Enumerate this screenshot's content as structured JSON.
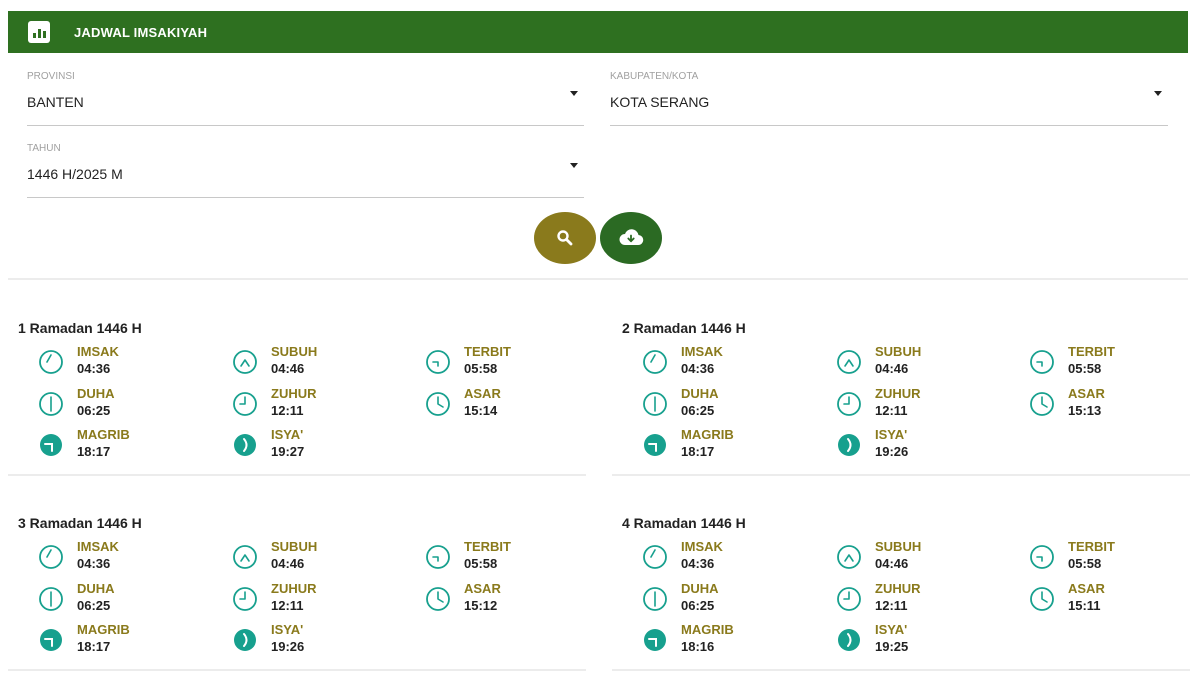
{
  "header": {
    "title": "JADWAL IMSAKIYAH",
    "icon": "bar-chart-icon"
  },
  "filters": {
    "provinsi": {
      "label": "PROVINSI",
      "value": "BANTEN"
    },
    "kota": {
      "label": "KABUPATEN/KOTA",
      "value": "KOTA SERANG"
    },
    "tahun": {
      "label": "TAHUN",
      "value": "1446 H/2025 M"
    }
  },
  "actions": {
    "search_icon": "search-icon",
    "download_icon": "cloud-download-icon"
  },
  "colors": {
    "header": "#2e7020",
    "search_button": "#8a7a1c",
    "download_button": "#2b6a23",
    "icon_teal": "#17a08e",
    "label_olive": "#8a7a1c"
  },
  "days": [
    {
      "title": "1 Ramadan 1446 H",
      "times": [
        {
          "name": "IMSAK",
          "time": "04:36"
        },
        {
          "name": "SUBUH",
          "time": "04:46"
        },
        {
          "name": "TERBIT",
          "time": "05:58"
        },
        {
          "name": "DUHA",
          "time": "06:25"
        },
        {
          "name": "ZUHUR",
          "time": "12:11"
        },
        {
          "name": "ASAR",
          "time": "15:14"
        },
        {
          "name": "MAGRIB",
          "time": "18:17"
        },
        {
          "name": "ISYA'",
          "time": "19:27"
        }
      ]
    },
    {
      "title": "2 Ramadan 1446 H",
      "times": [
        {
          "name": "IMSAK",
          "time": "04:36"
        },
        {
          "name": "SUBUH",
          "time": "04:46"
        },
        {
          "name": "TERBIT",
          "time": "05:58"
        },
        {
          "name": "DUHA",
          "time": "06:25"
        },
        {
          "name": "ZUHUR",
          "time": "12:11"
        },
        {
          "name": "ASAR",
          "time": "15:13"
        },
        {
          "name": "MAGRIB",
          "time": "18:17"
        },
        {
          "name": "ISYA'",
          "time": "19:26"
        }
      ]
    },
    {
      "title": "3 Ramadan 1446 H",
      "times": [
        {
          "name": "IMSAK",
          "time": "04:36"
        },
        {
          "name": "SUBUH",
          "time": "04:46"
        },
        {
          "name": "TERBIT",
          "time": "05:58"
        },
        {
          "name": "DUHA",
          "time": "06:25"
        },
        {
          "name": "ZUHUR",
          "time": "12:11"
        },
        {
          "name": "ASAR",
          "time": "15:12"
        },
        {
          "name": "MAGRIB",
          "time": "18:17"
        },
        {
          "name": "ISYA'",
          "time": "19:26"
        }
      ]
    },
    {
      "title": "4 Ramadan 1446 H",
      "times": [
        {
          "name": "IMSAK",
          "time": "04:36"
        },
        {
          "name": "SUBUH",
          "time": "04:46"
        },
        {
          "name": "TERBIT",
          "time": "05:58"
        },
        {
          "name": "DUHA",
          "time": "06:25"
        },
        {
          "name": "ZUHUR",
          "time": "12:11"
        },
        {
          "name": "ASAR",
          "time": "15:11"
        },
        {
          "name": "MAGRIB",
          "time": "18:16"
        },
        {
          "name": "ISYA'",
          "time": "19:25"
        }
      ]
    }
  ]
}
